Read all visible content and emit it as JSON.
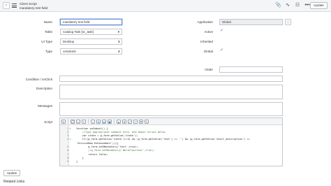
{
  "header": {
    "back_icon": "chevron-left-icon",
    "menu_icon": "hamburger-menu-icon",
    "title": "Client Script",
    "subtitle": "mandatory test field",
    "icons": [
      "paperclip-icon",
      "activity-icon",
      "settings-sliders-icon",
      "more-icon"
    ],
    "more_label": "•••",
    "update_label": "Update"
  },
  "form": {
    "name_label": "Name",
    "name_value": "mandatory test field",
    "table_label": "Table",
    "table_value": "Catalog Task [sc_task]",
    "ui_type_label": "UI Type",
    "ui_type_value": "Desktop",
    "type_label": "Type",
    "type_value": "onSubmit",
    "application_label": "Application",
    "application_value": "Global",
    "active_label": "Active",
    "active_checked": true,
    "inherited_label": "Inherited",
    "inherited_checked": false,
    "global_label": "Global",
    "global_checked": true,
    "order_label": "Order",
    "order_value": "",
    "condition_label": "Condition / onClick",
    "condition_value": "",
    "description_label": "Description",
    "description_value": "",
    "messages_label": "Messages",
    "messages_value": "",
    "script_label": "Script"
  },
  "script_lines": [
    {
      "n": "1",
      "text": "function onSubmit() {",
      "fold": true,
      "comment": false
    },
    {
      "n": "2",
      "text": "    //Type appropriate comment here, and begin script below",
      "fold": false,
      "comment": true
    },
    {
      "n": "3",
      "text": "    var state = g_form.getValue('state');",
      "fold": false,
      "comment": false
    },
    {
      "n": "4",
      "text": "    if((g_form.getValue('state')==3) && (g_form.getValue('test') == '') && (g_form.getValue('short_description') ==",
      "fold": true,
      "comment": false
    },
    {
      "n": "",
      "text": "'ServiceNow Enhancement'))){",
      "fold": false,
      "comment": false
    },
    {
      "n": "5",
      "text": "        g_form.setMandatory('test',true);",
      "fold": false,
      "comment": false
    },
    {
      "n": "6",
      "text": "        //g_form.setMandatory('Workflow=test',true);",
      "fold": false,
      "comment": true
    },
    {
      "n": "7",
      "text": "        return false;",
      "fold": false,
      "comment": false
    },
    {
      "n": "8",
      "text": "    }",
      "fold": false,
      "comment": false
    },
    {
      "n": "9",
      "text": "}",
      "fold": false,
      "comment": false
    }
  ],
  "footer": {
    "update_label": "Update",
    "related_links": "Related Links"
  },
  "colors": {
    "header_bg": "#f4f5f6",
    "focus": "#6b8fd6",
    "check": "#4a6fb5"
  }
}
